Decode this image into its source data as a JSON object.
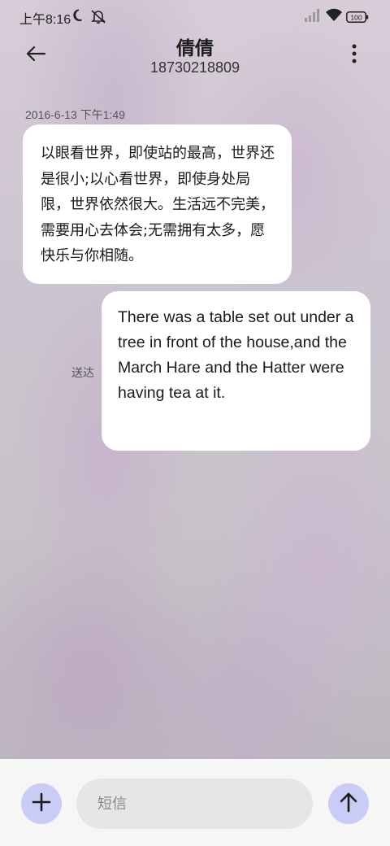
{
  "status_bar": {
    "time": "上午8:16",
    "battery": "100"
  },
  "header": {
    "contact_name": "倩倩",
    "contact_number": "18730218809"
  },
  "messages": [
    {
      "direction": "incoming",
      "timestamp": "2016-6-13 下午1:49",
      "text": "以眼看世界，即使站的最高，世界还是很小;以心看世界，即使身处局限，世界依然很大。生活远不完美，需要用心去体会;无需拥有太多，愿快乐与你相随。"
    },
    {
      "direction": "outgoing",
      "status": "送达",
      "text": "There was a table set out under a tree in front of the house,and the March Hare and the Hatter were having tea at it."
    }
  ],
  "compose": {
    "placeholder": "短信",
    "value": ""
  },
  "icons": {
    "back": "back-arrow-icon",
    "more": "more-vertical-icon",
    "add": "plus-icon",
    "send": "send-arrow-icon"
  },
  "colors": {
    "accent_button": "#c9ccf5",
    "bubble": "#ffffff",
    "input_background": "#e6e6e6",
    "compose_bar": "#f6f6f6"
  }
}
